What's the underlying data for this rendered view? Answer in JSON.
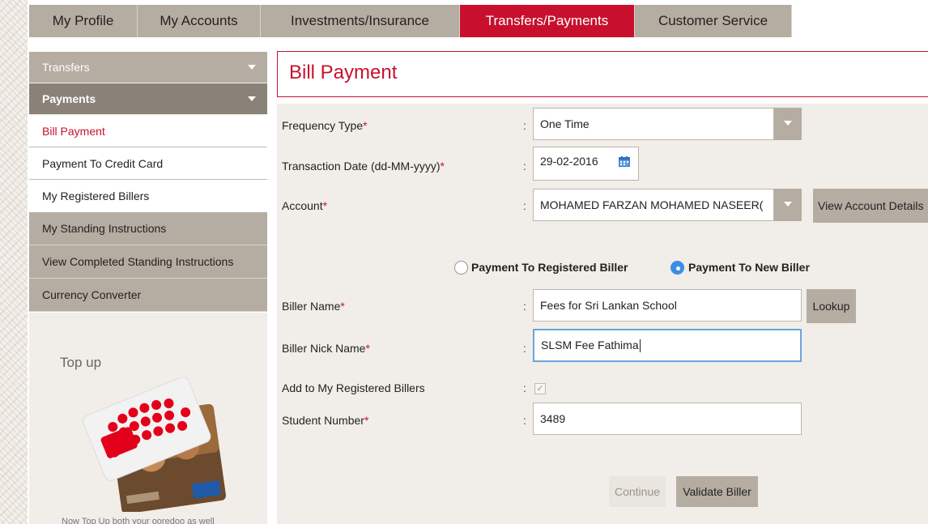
{
  "nav": {
    "tabs": [
      {
        "label": "My Profile",
        "active": false
      },
      {
        "label": "My Accounts",
        "active": false
      },
      {
        "label": "Investments/Insurance",
        "active": false
      },
      {
        "label": "Transfers/Payments",
        "active": true
      },
      {
        "label": "Customer Service",
        "active": false
      }
    ]
  },
  "sidebar": {
    "transfers": "Transfers",
    "payments": "Payments",
    "items": [
      {
        "label": "Bill Payment",
        "active": true
      },
      {
        "label": "Payment To Credit Card",
        "active": false
      },
      {
        "label": "My Registered Billers",
        "active": false
      }
    ],
    "more": [
      "My Standing Instructions",
      "View Completed Standing Instructions",
      "Currency Converter"
    ],
    "topup": {
      "title": "Top up",
      "caption": "Now Top Up both your ooredoo as well"
    }
  },
  "page": {
    "title": "Bill Payment"
  },
  "form": {
    "frequency": {
      "label": "Frequency Type",
      "value": "One Time"
    },
    "date": {
      "label": "Transaction Date (dd-MM-yyyy)",
      "value": "29-02-2016"
    },
    "account": {
      "label": "Account",
      "value": "MOHAMED FARZAN MOHAMED NASEER(",
      "details_button": "View Account Details"
    },
    "radio": {
      "registered": "Payment To Registered Biller",
      "new": "Payment To New Biller",
      "selected": "new"
    },
    "biller_name": {
      "label": "Biller Name",
      "value": "Fees for Sri Lankan  School",
      "lookup_button": "Lookup"
    },
    "nick_name": {
      "label": "Biller Nick Name",
      "value": "SLSM Fee Fathima"
    },
    "add_registered": {
      "label": "Add to My Registered Billers",
      "checked": true
    },
    "student_number": {
      "label": "Student Number",
      "value": "3489"
    },
    "continue_button": "Continue",
    "validate_button": "Validate Biller",
    "required_mark": "*",
    "colon": ":"
  },
  "colors": {
    "accent": "#c8102e",
    "tab_bg": "#b5ada2",
    "panel_bg": "#f1ede8",
    "radio_selected": "#3a8ee6"
  }
}
